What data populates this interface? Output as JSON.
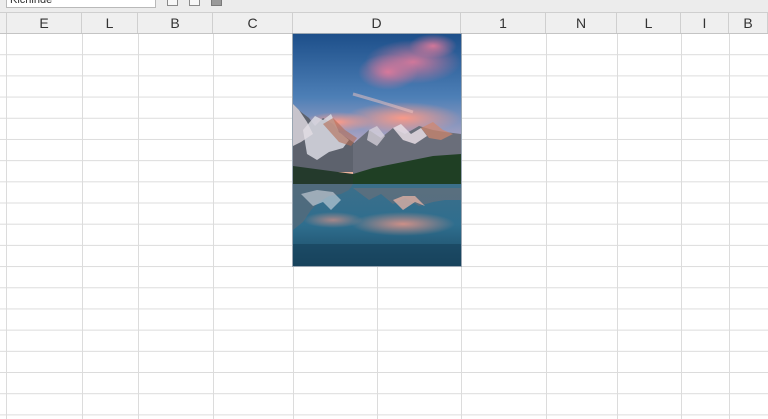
{
  "toolbar": {
    "name_box": "Kichinde"
  },
  "columns": [
    "E",
    "L",
    "B",
    "C",
    "D",
    "1",
    "N",
    "L",
    "I",
    "B"
  ],
  "picture": {
    "subject": "mountain lake landscape at sunset",
    "colors": {
      "sky_top": "#1f5b95",
      "sky_horizon": "#e9a08a",
      "cloud": "#f08a78",
      "mountain": "#6b6f78",
      "snow": "#e8e4ea",
      "forest": "#1e3d22",
      "water": "#245a78"
    }
  }
}
